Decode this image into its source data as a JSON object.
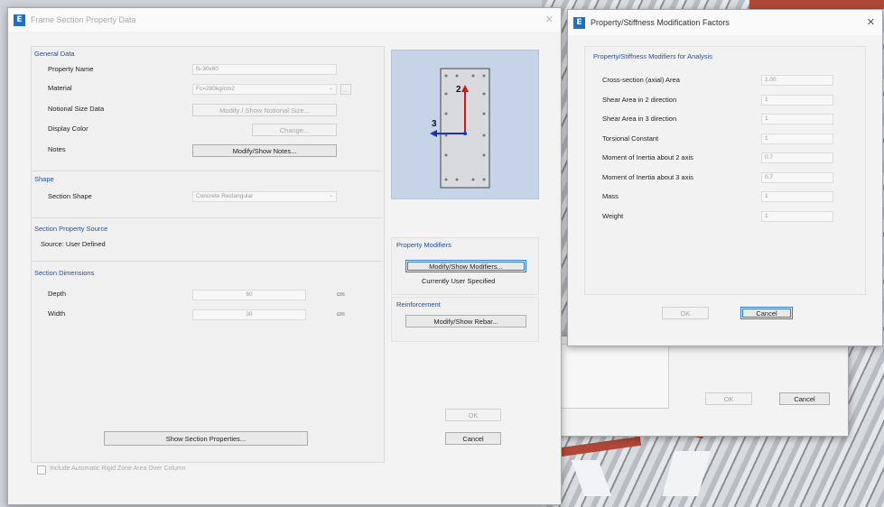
{
  "left_dialog": {
    "title": "Frame Section Property Data",
    "general_data": {
      "heading": "General Data",
      "property_name_label": "Property Name",
      "property_name_value": "fs-30x60",
      "material_label": "Material",
      "material_value": "Fc=280kg/cm2",
      "notional_size_label": "Notional Size Data",
      "notional_size_button": "Modify / Show Notional Size...",
      "display_color_label": "Display Color",
      "display_color_button": "Change...",
      "notes_label": "Notes",
      "notes_button": "Modify/Show Notes..."
    },
    "shape": {
      "heading": "Shape",
      "section_shape_label": "Section Shape",
      "section_shape_value": "Concrete Rectangular"
    },
    "source": {
      "heading": "Section Property Source",
      "source_text": "Source: User Defined"
    },
    "dimensions": {
      "heading": "Section Dimensions",
      "depth_label": "Depth",
      "depth_value": "60",
      "depth_unit": "cm",
      "width_label": "Width",
      "width_value": "30",
      "width_unit": "cm"
    },
    "show_props_button": "Show Section Properties...",
    "rigid_zone_checkbox": "Include Automatic Rigid Zone Area Over Column",
    "preview": {
      "axis2": "2",
      "axis3": "3"
    },
    "property_modifiers": {
      "heading": "Property Modifiers",
      "button": "Modify/Show Modifiers...",
      "status": "Currently User Specified"
    },
    "reinforcement": {
      "heading": "Reinforcement",
      "button": "Modify/Show Rebar..."
    },
    "ok": "OK",
    "cancel": "Cancel"
  },
  "right_dialog": {
    "title": "Property/Stiffness Modification Factors",
    "heading": "Property/Stiffness Modifiers for Analysis",
    "rows": [
      {
        "label": "Cross-section (axial) Area",
        "value": "1.00"
      },
      {
        "label": "Shear Area in 2 direction",
        "value": "1"
      },
      {
        "label": "Shear Area in 3 direction",
        "value": "1"
      },
      {
        "label": "Torsional Constant",
        "value": "1"
      },
      {
        "label": "Moment of Inertia about 2 axis",
        "value": "0.7"
      },
      {
        "label": "Moment of Inertia about 3 axis",
        "value": "0.7"
      },
      {
        "label": "Mass",
        "value": "1"
      },
      {
        "label": "Weight",
        "value": "1"
      }
    ],
    "ok": "OK",
    "cancel": "Cancel"
  },
  "back_dialog": {
    "ok": "OK",
    "cancel": "Cancel"
  }
}
